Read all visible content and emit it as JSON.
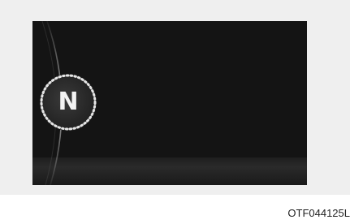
{
  "display": {
    "gear_indicator": "N"
  },
  "figure_code": "OTF044125L",
  "colors": {
    "panel_background": "#efefef",
    "screen_background": "#141414",
    "indicator_ring": "#e6e6e6",
    "indicator_text": "#f2f2f2"
  },
  "icons": [
    "gear-position-ring-icon",
    "tachometer-arc-icon"
  ]
}
